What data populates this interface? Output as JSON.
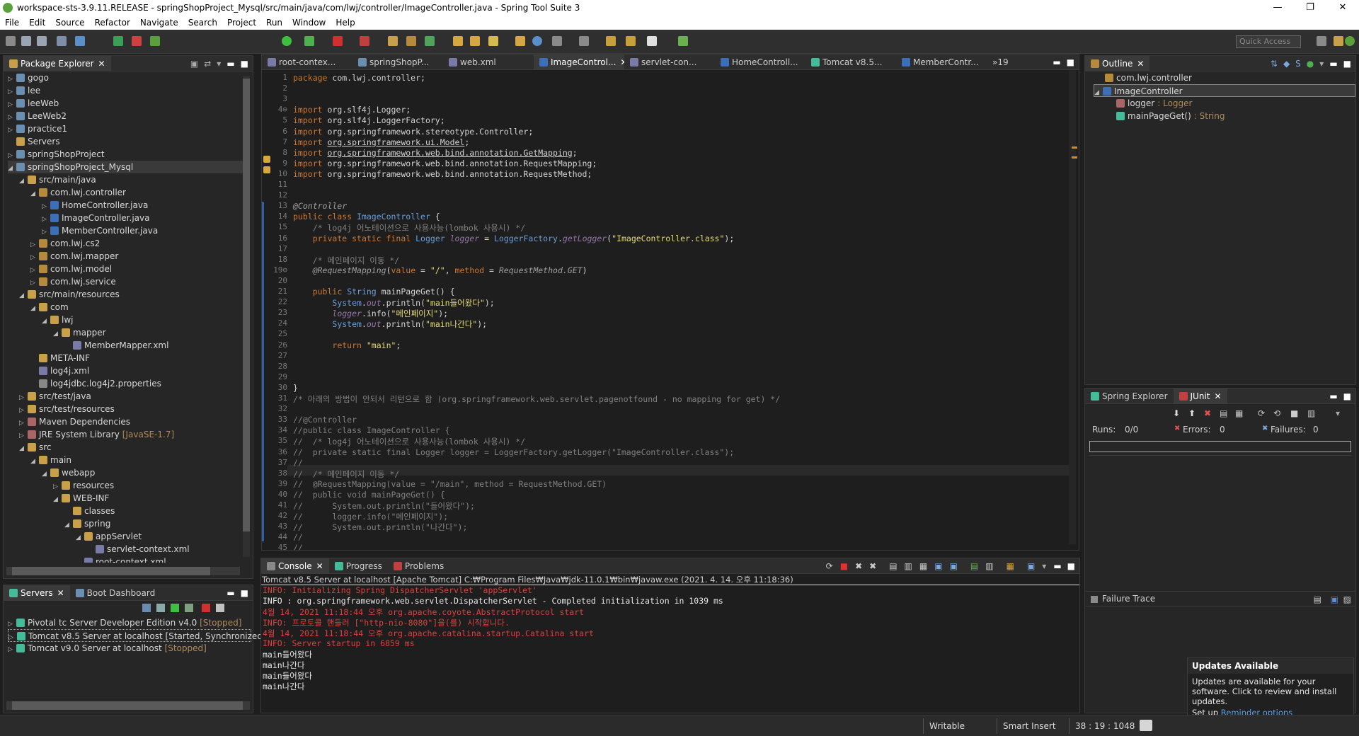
{
  "window": {
    "title": "workspace-sts-3.9.11.RELEASE - springShopProject_Mysql/src/main/java/com/lwj/controller/ImageController.java - Spring Tool Suite 3",
    "controls": [
      "—",
      "❐",
      "✕"
    ]
  },
  "menu": [
    "File",
    "Edit",
    "Source",
    "Refactor",
    "Navigate",
    "Search",
    "Project",
    "Run",
    "Window",
    "Help"
  ],
  "toolbar": {
    "quick_access_placeholder": "Quick Access"
  },
  "package_explorer": {
    "title": "Package Explorer",
    "items": [
      {
        "label": "gogo",
        "depth": 0,
        "icon": "project-icon"
      },
      {
        "label": "lee",
        "depth": 0,
        "icon": "project-icon"
      },
      {
        "label": "leeWeb",
        "depth": 0,
        "icon": "project-icon"
      },
      {
        "label": "LeeWeb2",
        "depth": 0,
        "icon": "project-icon"
      },
      {
        "label": "practice1",
        "depth": 0,
        "icon": "project-icon"
      },
      {
        "label": "Servers",
        "depth": 0,
        "icon": "folder-icon"
      },
      {
        "label": "springShopProject",
        "depth": 0,
        "icon": "project-icon"
      },
      {
        "label": "springShopProject_Mysql",
        "depth": 0,
        "icon": "project-icon"
      },
      {
        "label": "src/main/java",
        "depth": 1,
        "icon": "source-folder-icon"
      },
      {
        "label": "com.lwj.controller",
        "depth": 2,
        "icon": "package-icon"
      },
      {
        "label": "HomeController.java",
        "depth": 3,
        "icon": "java-file-icon"
      },
      {
        "label": "ImageController.java",
        "depth": 3,
        "icon": "java-file-icon"
      },
      {
        "label": "MemberController.java",
        "depth": 3,
        "icon": "java-file-icon"
      },
      {
        "label": "com.lwj.cs2",
        "depth": 2,
        "icon": "package-icon"
      },
      {
        "label": "com.lwj.mapper",
        "depth": 2,
        "icon": "package-icon"
      },
      {
        "label": "com.lwj.model",
        "depth": 2,
        "icon": "package-icon"
      },
      {
        "label": "com.lwj.service",
        "depth": 2,
        "icon": "package-icon"
      },
      {
        "label": "src/main/resources",
        "depth": 1,
        "icon": "source-folder-icon"
      },
      {
        "label": "com",
        "depth": 2,
        "icon": "folder-icon"
      },
      {
        "label": "lwj",
        "depth": 3,
        "icon": "folder-icon"
      },
      {
        "label": "mapper",
        "depth": 4,
        "icon": "folder-icon"
      },
      {
        "label": "MemberMapper.xml",
        "depth": 5,
        "icon": "xml-file-icon"
      },
      {
        "label": "META-INF",
        "depth": 2,
        "icon": "folder-icon"
      },
      {
        "label": "log4j.xml",
        "depth": 2,
        "icon": "xml-file-icon"
      },
      {
        "label": "log4jdbc.log4j2.properties",
        "depth": 2,
        "icon": "properties-file-icon"
      },
      {
        "label": "src/test/java",
        "depth": 1,
        "icon": "source-folder-icon"
      },
      {
        "label": "src/test/resources",
        "depth": 1,
        "icon": "source-folder-icon"
      },
      {
        "label": "Maven Dependencies",
        "depth": 1,
        "icon": "library-icon"
      },
      {
        "label": "JRE System Library",
        "suffix": "[JavaSE-1.7]",
        "depth": 1,
        "icon": "library-icon"
      },
      {
        "label": "src",
        "depth": 1,
        "icon": "folder-icon"
      },
      {
        "label": "main",
        "depth": 2,
        "icon": "folder-icon"
      },
      {
        "label": "webapp",
        "depth": 3,
        "icon": "folder-icon"
      },
      {
        "label": "resources",
        "depth": 4,
        "icon": "folder-icon"
      },
      {
        "label": "WEB-INF",
        "depth": 4,
        "icon": "folder-icon"
      },
      {
        "label": "classes",
        "depth": 5,
        "icon": "folder-icon"
      },
      {
        "label": "spring",
        "depth": 5,
        "icon": "folder-icon"
      },
      {
        "label": "appServlet",
        "depth": 6,
        "icon": "folder-icon"
      },
      {
        "label": "servlet-context.xml",
        "depth": 7,
        "icon": "xml-file-icon"
      },
      {
        "label": "root-context.xml",
        "depth": 6,
        "icon": "xml-file-icon"
      }
    ]
  },
  "servers": {
    "tabs": [
      "Servers",
      "Boot Dashboard"
    ],
    "items": [
      {
        "label": "Pivotal tc Server Developer Edition v4.0",
        "state": "[Stopped]"
      },
      {
        "label": "Tomcat v8.5 Server at localhost",
        "state": "[Started, Synchronized]"
      },
      {
        "label": "Tomcat v9.0 Server at localhost",
        "state": "[Stopped]"
      }
    ]
  },
  "editor": {
    "tabs": [
      "root-contex...",
      "springShopP...",
      "web.xml",
      "ImageControl...",
      "servlet-con...",
      "HomeControll...",
      "Tomcat v8.5...",
      "MemberContr...",
      "»19"
    ],
    "active_tab": 3
  },
  "outline": {
    "title": "Outline",
    "items": [
      {
        "label": "com.lwj.controller",
        "type": ""
      },
      {
        "label": "ImageController",
        "type": ""
      },
      {
        "label": "logger",
        "type": ": Logger"
      },
      {
        "label": "mainPageGet()",
        "type": ": String"
      }
    ]
  },
  "junit": {
    "tabs": [
      "Spring Explorer",
      "JUnit"
    ],
    "runs_label": "Runs:",
    "runs_value": "0/0",
    "errors_label": "Errors:",
    "errors_value": "0",
    "failures_label": "Failures:",
    "failures_value": "0",
    "failure_trace": "Failure Trace"
  },
  "console": {
    "tabs": [
      "Console",
      "Progress",
      "Problems"
    ],
    "header": "Tomcat v8.5 Server at localhost [Apache Tomcat] C:₩Program Files₩Java₩jdk-11.0.1₩bin₩javaw.exe (2021. 4. 14. 오후 11:18:36)",
    "lines": [
      {
        "text": "INFO: Initializing Spring DispatcherServlet 'appServlet'",
        "color": "red"
      },
      {
        "text": "INFO : org.springframework.web.servlet.DispatcherServlet - Completed initialization in 1039 ms",
        "color": "white"
      },
      {
        "text": "4월 14, 2021 11:18:44 오후 org.apache.coyote.AbstractProtocol start",
        "color": "red"
      },
      {
        "text": "INFO: 프로토콜 핸들러 [\"http-nio-8080\"]을(를) 시작합니다.",
        "color": "red"
      },
      {
        "text": "4월 14, 2021 11:18:44 오후 org.apache.catalina.startup.Catalina start",
        "color": "red"
      },
      {
        "text": "INFO: Server startup in 6859 ms",
        "color": "red"
      },
      {
        "text": "main들어왔다",
        "color": "white"
      },
      {
        "text": "main나간다",
        "color": "white"
      },
      {
        "text": "main들어왔다",
        "color": "white"
      },
      {
        "text": "main나간다",
        "color": "white"
      }
    ]
  },
  "updates": {
    "title": "Updates Available",
    "body": "Updates are available for your software. Click to review and install updates.",
    "setup_prefix": "Set up",
    "link": "Reminder options"
  },
  "status": {
    "writable": "Writable",
    "insert": "Smart Insert",
    "position": "38 : 19 : 1048"
  }
}
